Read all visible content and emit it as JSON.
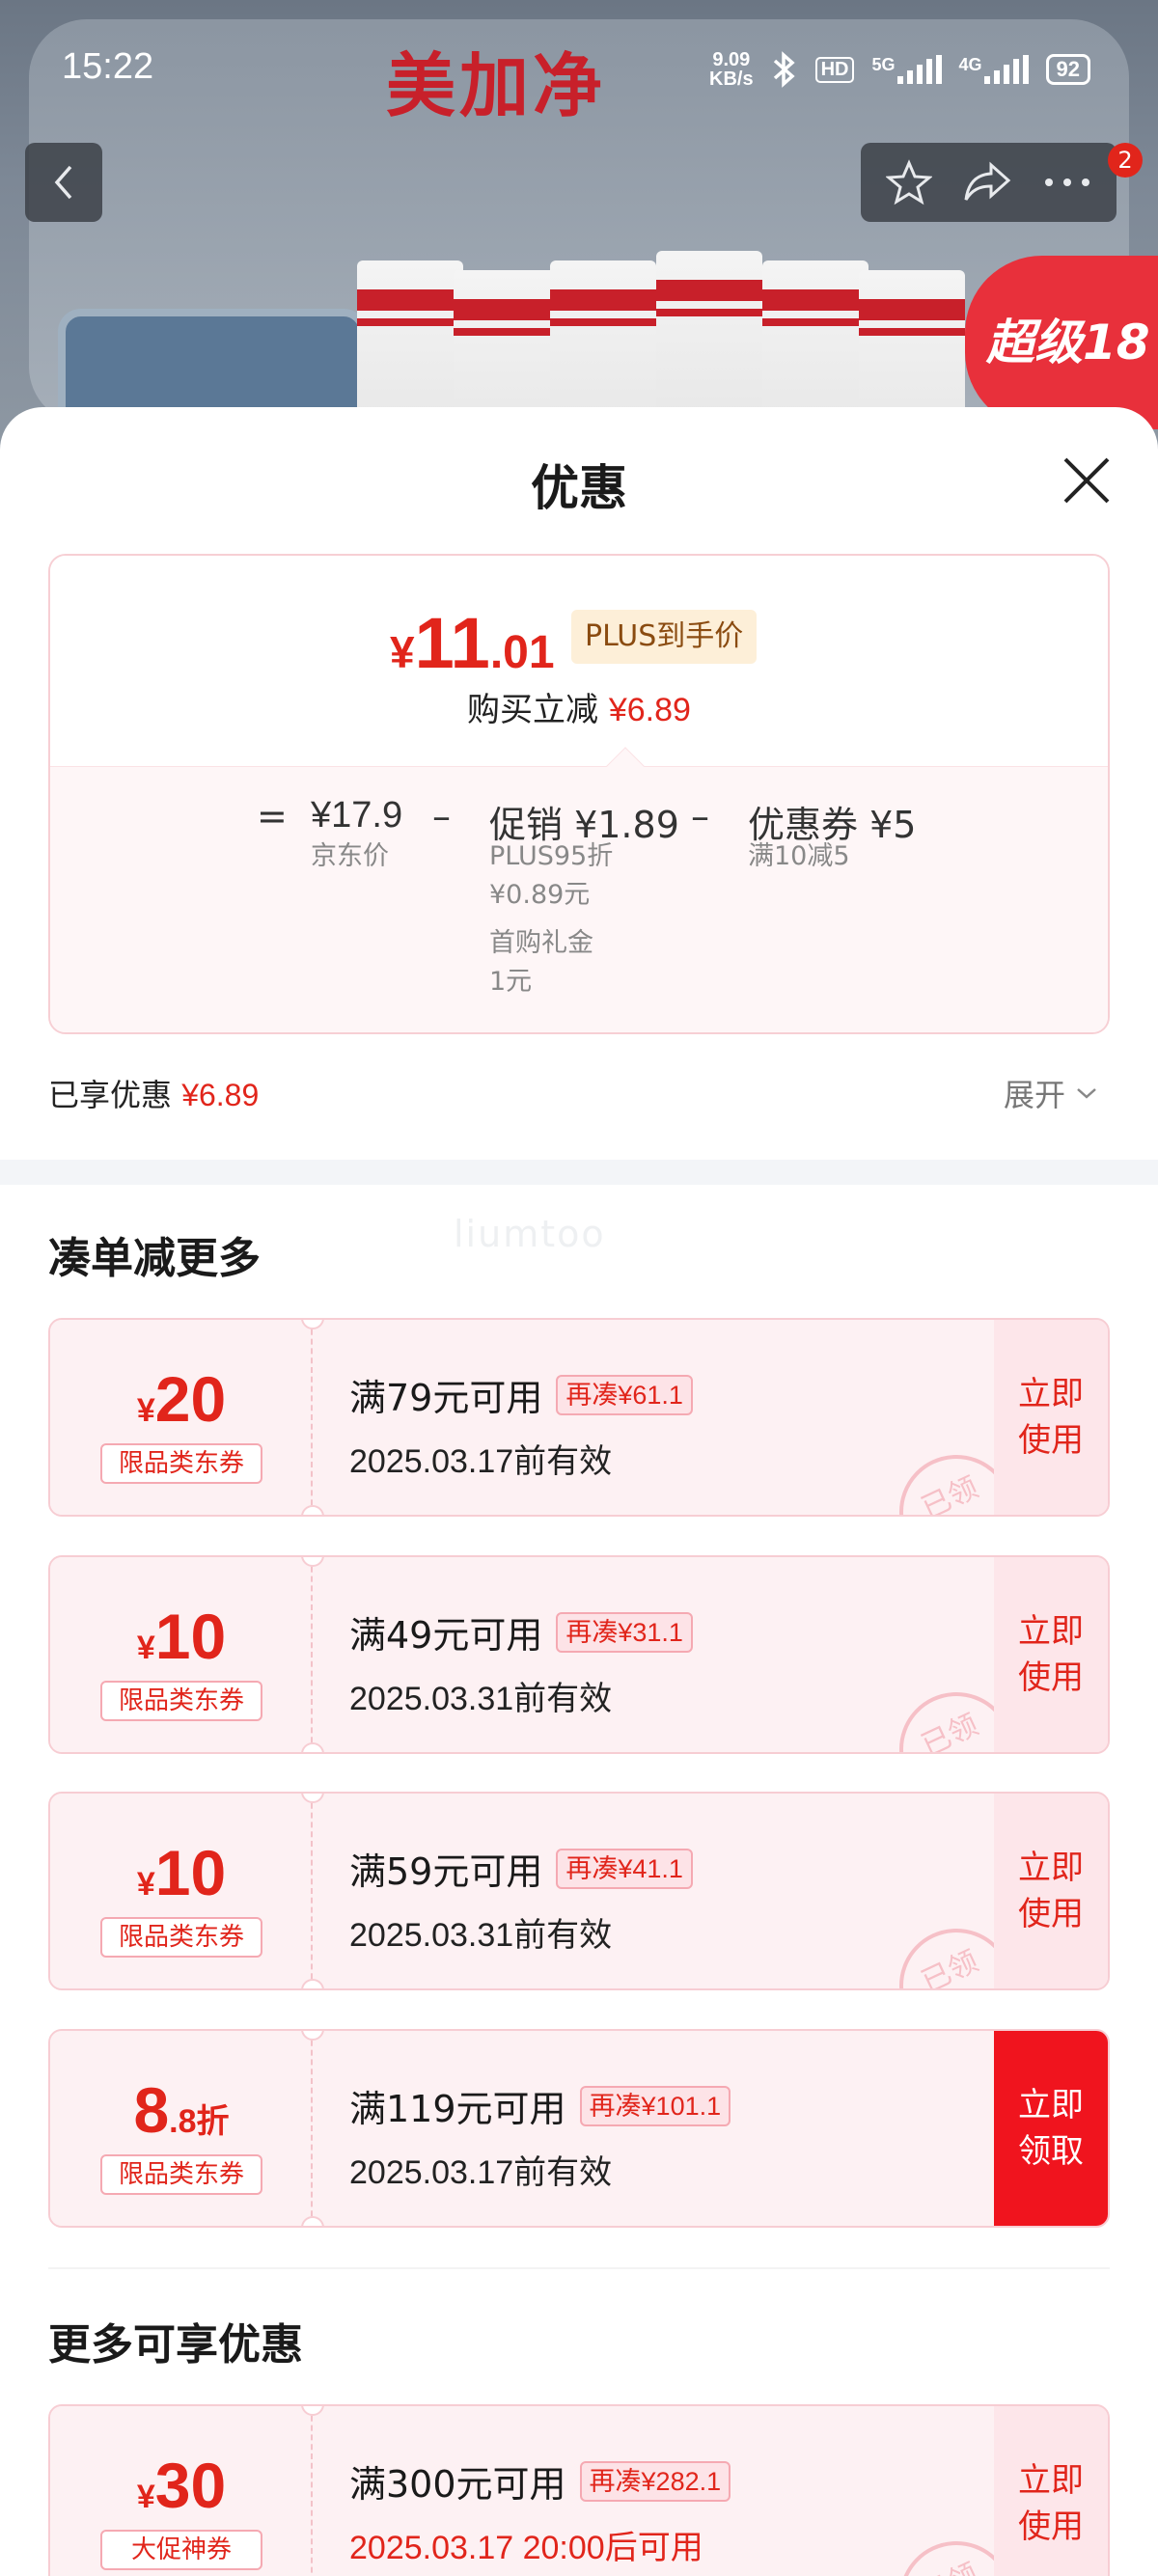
{
  "statusbar": {
    "time": "15:22",
    "net_speed_top": "9.09",
    "net_speed_bottom": "KB/s",
    "hd_label": "HD",
    "sig1_label": "5G",
    "sig2_label": "4G",
    "battery": "92"
  },
  "backdrop": {
    "brand": "美加净",
    "badge_text": "超级18"
  },
  "nav": {
    "notification_count": "2"
  },
  "sheet": {
    "title": "优惠"
  },
  "price": {
    "currency": "¥",
    "integer": "11",
    "decimal": ".01",
    "plus_tag": "PLUS到手价",
    "save_prefix": "购买立减",
    "save_amount": "¥6.89"
  },
  "breakdown": {
    "equals": "=",
    "minus": "–",
    "jd_price": "¥17.9",
    "jd_price_label": "京东价",
    "promo": "促销 ¥1.89",
    "promo_detail_1": "PLUS95折",
    "promo_detail_2": "¥0.89元",
    "promo_detail_3": "首购礼金",
    "promo_detail_4": "1元",
    "coupon": "优惠券 ¥5",
    "coupon_detail": "满10减5"
  },
  "enjoyed": {
    "label": "已享优惠",
    "amount": "¥6.89",
    "expand": "展开"
  },
  "section_more": {
    "title": "凑单减更多",
    "watermark": "liumtoo"
  },
  "coupons": [
    {
      "cur": "¥",
      "num": "20",
      "small": "",
      "kind": "限品类东券",
      "cond": "满79元可用",
      "more": "再凑¥61.1",
      "valid": "2025.03.17前有效",
      "action": "立即使用",
      "stamp": "已领"
    },
    {
      "cur": "¥",
      "num": "10",
      "small": "",
      "kind": "限品类东券",
      "cond": "满49元可用",
      "more": "再凑¥31.1",
      "valid": "2025.03.31前有效",
      "action": "立即使用",
      "stamp": "已领"
    },
    {
      "cur": "¥",
      "num": "10",
      "small": "",
      "kind": "限品类东券",
      "cond": "满59元可用",
      "more": "再凑¥41.1",
      "valid": "2025.03.31前有效",
      "action": "立即使用",
      "stamp": "已领"
    },
    {
      "cur": "",
      "num": "8",
      "small": ".8折",
      "kind": "限品类东券",
      "cond": "满119元可用",
      "more": "再凑¥101.1",
      "valid": "2025.03.17前有效",
      "action": "立即领取",
      "stamp": ""
    }
  ],
  "section_enjoy": {
    "title": "更多可享优惠"
  },
  "coupons_more": [
    {
      "cur": "¥",
      "num": "30",
      "kind": "大促神券",
      "cond": "满300元可用",
      "more": "再凑¥282.1",
      "valid": "2025.03.17 20:00后可用",
      "action": "立即使用",
      "stamp": "已领"
    }
  ],
  "colors": {
    "accent": "#e1251b",
    "coupon_bg": "#fdf1f3",
    "plus_bg": "#fdefd8"
  }
}
